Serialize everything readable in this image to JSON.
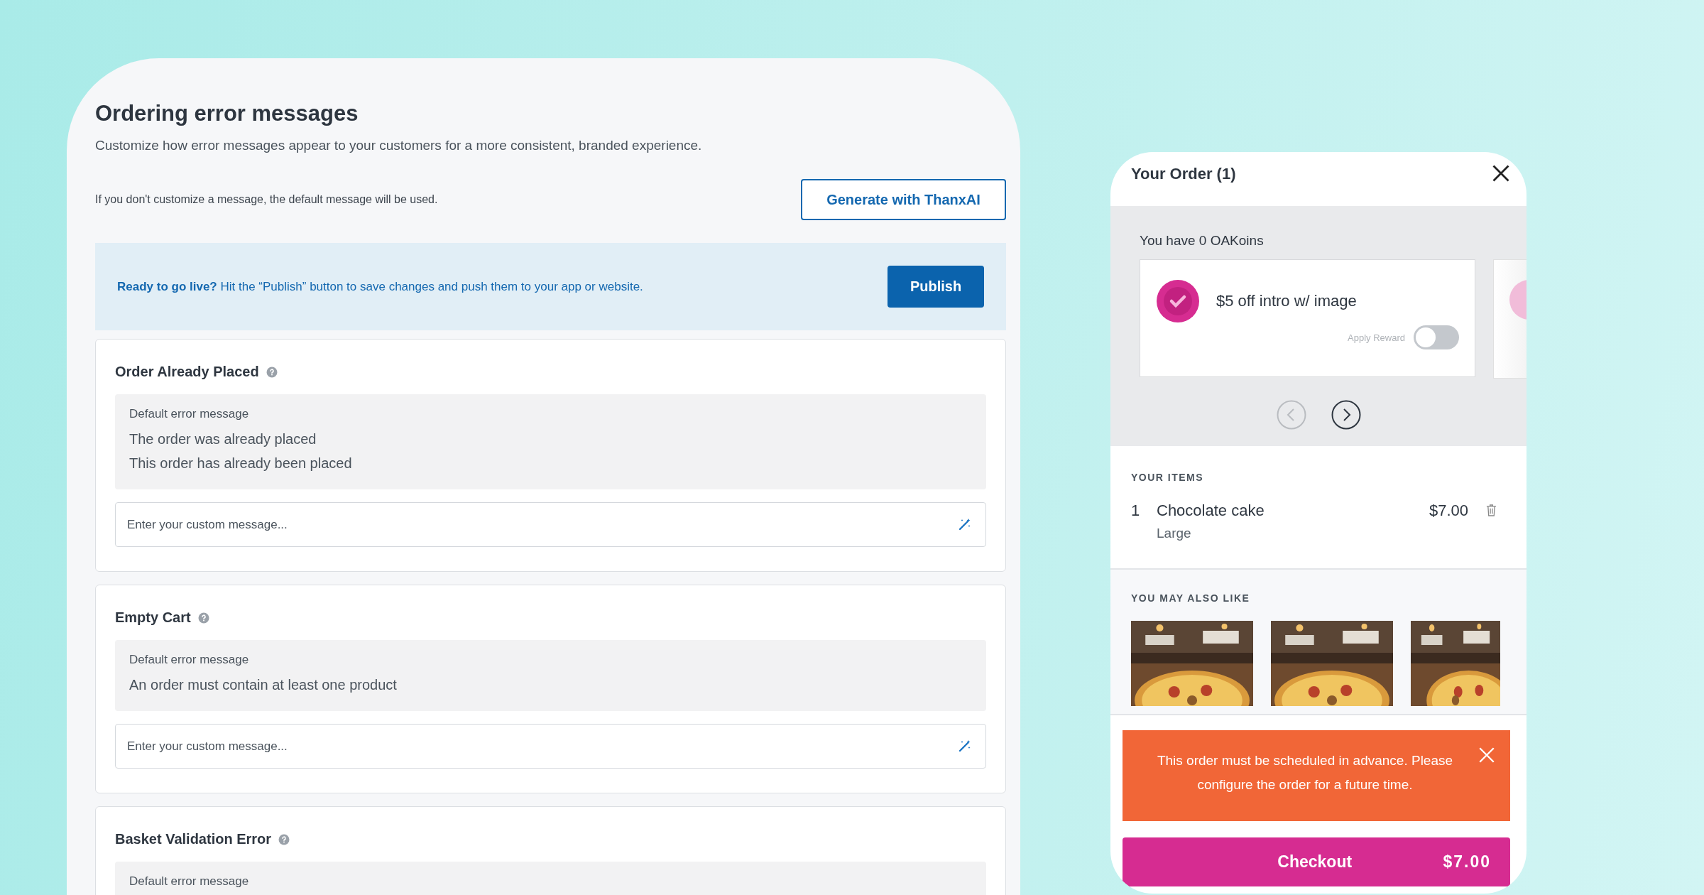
{
  "editor": {
    "title": "Ordering error messages",
    "subtitle": "Customize how error messages appear to your customers for a more consistent, branded experience.",
    "note": "If you don't customize a message, the default message will be used.",
    "generate_button": "Generate with ThanxAI",
    "banner": {
      "text": "**Ready to go live?** Hit the “Publish” button to save changes and push them to your app or website.",
      "button": "Publish"
    },
    "cards": [
      {
        "title": "Order Already Placed",
        "default_label": "Default error message",
        "messages": [
          "The order was already placed",
          "This order has already been placed"
        ],
        "placeholder": "Enter your custom message..."
      },
      {
        "title": "Empty Cart",
        "default_label": "Default error message",
        "messages": [
          "An order must contain at least one product"
        ],
        "placeholder": "Enter your custom message..."
      },
      {
        "title": "Basket Validation Error",
        "default_label": "Default error message"
      }
    ]
  },
  "cart": {
    "title": "Your Order (1)",
    "points": "You have 0 OAKoins",
    "rewards": [
      {
        "name": "$5 off intro w/ image",
        "toggle_label": "Apply Reward",
        "on": false
      }
    ],
    "carousel": [
      {
        "kind": "prev",
        "disabled": true
      },
      {
        "kind": "next",
        "disabled": false
      }
    ],
    "items_heading": "YOUR ITEMS",
    "items": [
      {
        "qty": "1",
        "name": "Chocolate cake",
        "option": "Large",
        "price": "$7.00"
      }
    ],
    "suggest_heading": "YOU MAY ALSO LIKE",
    "alert": "This order must be scheduled in advance. Please configure the order for a future time.",
    "checkout": {
      "label": "Checkout",
      "total": "$7.00"
    }
  }
}
